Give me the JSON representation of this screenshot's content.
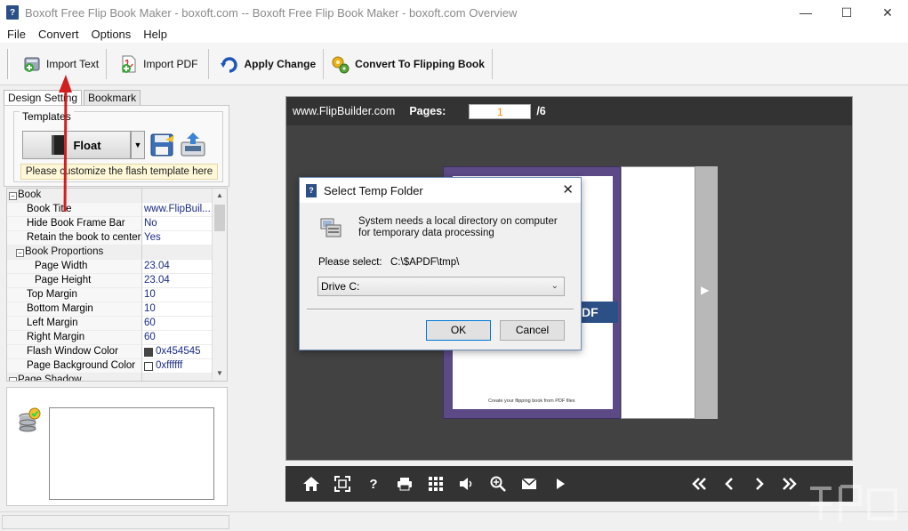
{
  "window": {
    "title": "Boxoft Free Flip Book Maker - boxoft.com -- Boxoft Free Flip Book Maker - boxoft.com Overview",
    "app_icon_glyph": "?",
    "minimize_glyph": "—",
    "maximize_glyph": "☐",
    "close_glyph": "✕"
  },
  "menu": [
    "File",
    "Convert",
    "Options",
    "Help"
  ],
  "toolbar": {
    "import_text": "Import Text",
    "import_pdf": "Import PDF",
    "apply_change": "Apply Change",
    "convert": "Convert To Flipping Book"
  },
  "left_panel": {
    "tabs": [
      "Design Setting",
      "Bookmark"
    ],
    "templates_label": "Templates",
    "template_name": "Float",
    "template_hint": "Please customize the flash template here"
  },
  "property_grid": {
    "rows": [
      {
        "name": "Book",
        "value": "",
        "type": "category",
        "indent": 0,
        "expander": "⊟"
      },
      {
        "name": "Book Title",
        "value": "www.FlipBuil...",
        "indent": 1
      },
      {
        "name": "Hide Book Frame Bar",
        "value": "No",
        "indent": 1
      },
      {
        "name": "Retain the book to center",
        "value": "Yes",
        "indent": 1
      },
      {
        "name": "Book Proportions",
        "value": "",
        "type": "category",
        "indent": 1,
        "expander": "⊟"
      },
      {
        "name": "Page Width",
        "value": "23.04",
        "indent": 2
      },
      {
        "name": "Page Height",
        "value": "23.04",
        "indent": 2
      },
      {
        "name": "Top Margin",
        "value": "10",
        "indent": 1
      },
      {
        "name": "Bottom Margin",
        "value": "10",
        "indent": 1
      },
      {
        "name": "Left Margin",
        "value": "60",
        "indent": 1
      },
      {
        "name": "Right Margin",
        "value": "60",
        "indent": 1
      },
      {
        "name": "Flash Window Color",
        "value": "0x454545",
        "indent": 1,
        "swatch": "#454545"
      },
      {
        "name": "Page Background Color",
        "value": "0xffffff",
        "indent": 1,
        "swatch": "#ffffff"
      },
      {
        "name": "Page Shadow",
        "value": "",
        "type": "category",
        "indent": 0,
        "expander": "⊟"
      }
    ]
  },
  "preview": {
    "url": "www.FlipBuilder.com",
    "pages_label": "Pages:",
    "current_page": "1",
    "total_pages": "/6",
    "pdf_text": "DF",
    "cover_tagline": "Create your flipping book from PDF files",
    "next_glyph": "▶"
  },
  "dialog": {
    "title": "Select Temp Folder",
    "message": "System needs a local directory on computer for temporary data processing",
    "select_label": "Please select:",
    "select_path": "C:\\$APDF\\tmp\\",
    "drive": "Drive C:",
    "ok": "OK",
    "cancel": "Cancel",
    "close_glyph": "✕",
    "chevron_glyph": "⌄"
  },
  "colors": {
    "book_frame": "#424242",
    "cover_purple": "#5b4a86",
    "cover_band": "#2c4f86",
    "page_number": "#ff8a00",
    "annotation_red": "#d11f1f"
  }
}
